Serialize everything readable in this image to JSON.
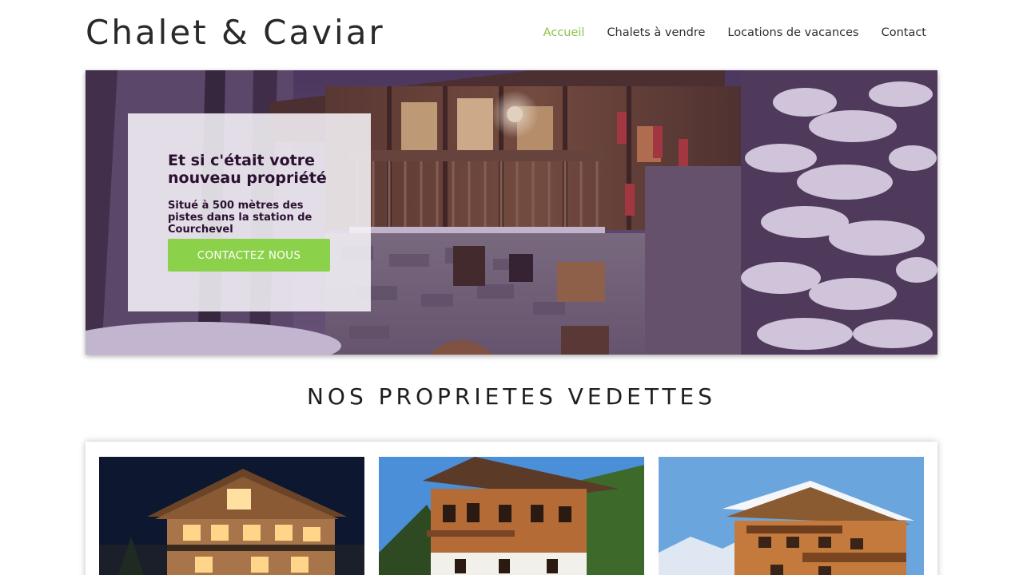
{
  "header": {
    "logo": "Chalet & Caviar",
    "nav": [
      {
        "label": "Accueil",
        "active": true
      },
      {
        "label": "Chalets à vendre",
        "active": false
      },
      {
        "label": "Locations de vacances",
        "active": false
      },
      {
        "label": "Contact",
        "active": false
      }
    ]
  },
  "hero": {
    "title": "Et si c'était votre nouveau propriété",
    "subtitle": "Situé à 500 mètres des pistes dans la station de Courchevel",
    "cta_label": "CONTACTEZ NOUS"
  },
  "featured": {
    "title": "NOS PROPRIETES VEDETTES",
    "listings": [
      {
        "image": "chalet-night-photo"
      },
      {
        "image": "chalet-summer-photo"
      },
      {
        "image": "chalet-snow-photo"
      }
    ]
  },
  "colors": {
    "accent": "#8bc34a",
    "button": "#8bd14a",
    "hero_text": "#2b1030"
  }
}
